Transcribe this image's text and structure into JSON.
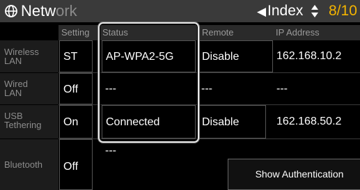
{
  "header": {
    "title_bright": "Netw",
    "title_dim": "ork",
    "network_icon": "globe-icon",
    "index_arrow": "◀",
    "index_label": "Index",
    "index_updown_icon": "up-down-triangles-icon",
    "page_indicator": "8/10"
  },
  "columns": {
    "setting": "Setting",
    "status": "Status",
    "remote": "Remote",
    "ip_address": "IP Address"
  },
  "rows": {
    "wireless": {
      "label": "Wireless LAN",
      "setting": "ST",
      "status": "AP-WPA2-5G",
      "remote": "Disable",
      "ip": "162.168.10.2"
    },
    "wired": {
      "label": "Wired LAN",
      "setting": "Off",
      "status": "---",
      "remote": "---",
      "ip": "---"
    },
    "usb": {
      "label": "USB Tethering",
      "setting": "On",
      "status": "Connected",
      "remote": "Disable",
      "ip": "162.168.50.2"
    },
    "bluetooth": {
      "label": "Bluetooth",
      "setting": "Off",
      "status": "---"
    }
  },
  "buttons": {
    "show_authentication": "Show Authentication"
  }
}
